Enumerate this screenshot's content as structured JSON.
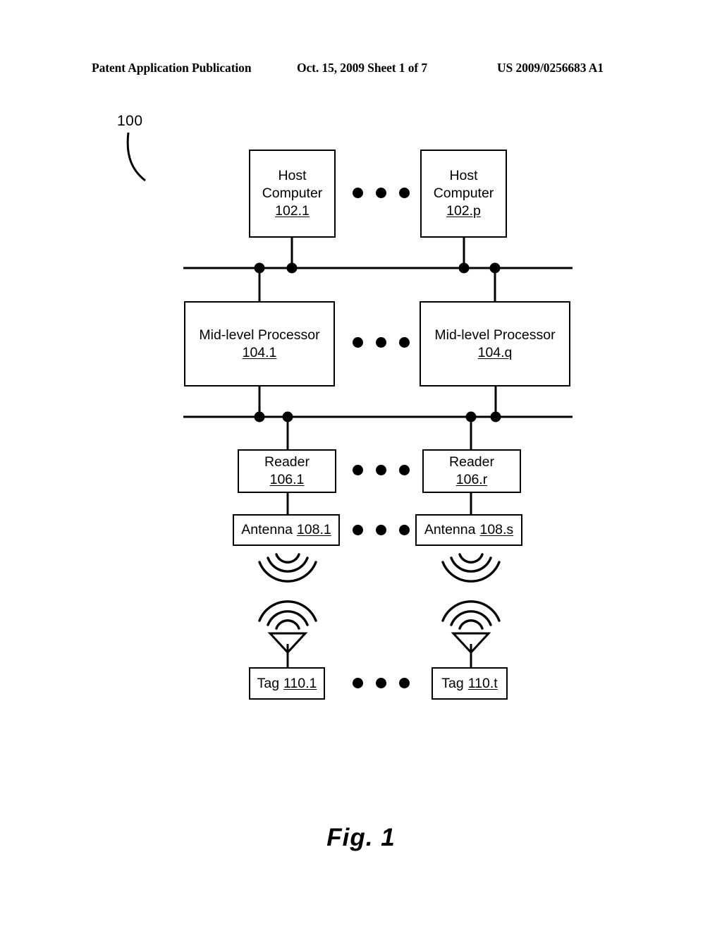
{
  "header": {
    "left": "Patent Application Publication",
    "middle": "Oct. 15, 2009  Sheet 1 of 7",
    "right": "US 2009/0256683 A1"
  },
  "figure": {
    "system_ref": "100",
    "caption": "Fig. 1",
    "ellipsis_glyph": "•••"
  },
  "nodes": {
    "host_a": {
      "label_line1": "Host",
      "label_line2": "Computer",
      "ref": "102.1"
    },
    "host_b": {
      "label_line1": "Host",
      "label_line2": "Computer",
      "ref": "102.p"
    },
    "mlp_a": {
      "label": "Mid-level Processor",
      "ref": "104.1"
    },
    "mlp_b": {
      "label": "Mid-level Processor",
      "ref": "104.q"
    },
    "reader_a": {
      "label": "Reader",
      "ref": "106.1"
    },
    "reader_b": {
      "label": "Reader",
      "ref": "106.r"
    },
    "antenna_a": {
      "label": "Antenna",
      "ref": "108.1"
    },
    "antenna_b": {
      "label": "Antenna",
      "ref": "108.s"
    },
    "tag_a": {
      "label": "Tag",
      "ref": "110.1"
    },
    "tag_b": {
      "label": "Tag",
      "ref": "110.t"
    }
  },
  "colors": {
    "ink": "#000000",
    "paper": "#ffffff"
  }
}
